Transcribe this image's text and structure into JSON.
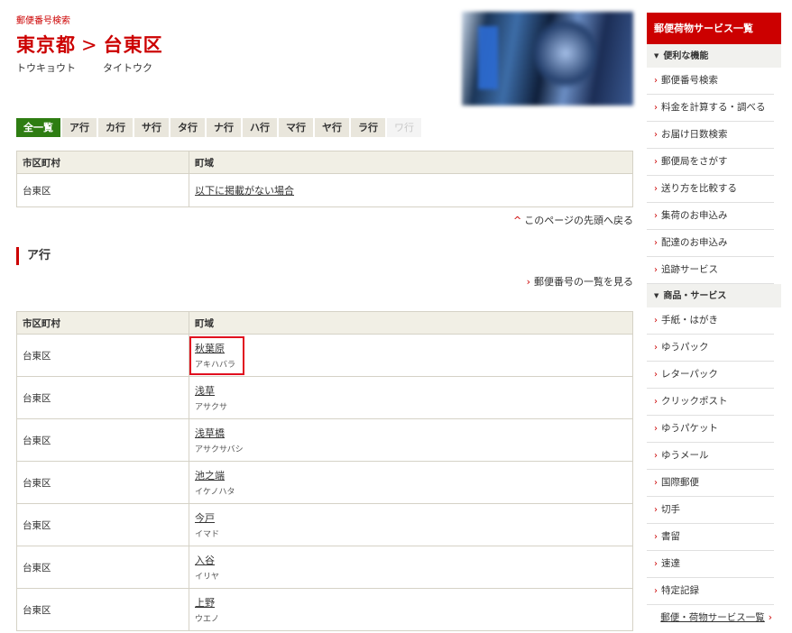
{
  "breadcrumb": "郵便番号検索",
  "title": {
    "pref": "東京都",
    "sep": ">",
    "city": "台東区"
  },
  "kana": {
    "pref": "トウキョウト",
    "city": "タイトウク"
  },
  "tabs": [
    {
      "label": "全一覧",
      "state": "active"
    },
    {
      "label": "ア行",
      "state": "normal"
    },
    {
      "label": "カ行",
      "state": "normal"
    },
    {
      "label": "サ行",
      "state": "normal"
    },
    {
      "label": "タ行",
      "state": "normal"
    },
    {
      "label": "ナ行",
      "state": "normal"
    },
    {
      "label": "ハ行",
      "state": "normal"
    },
    {
      "label": "マ行",
      "state": "normal"
    },
    {
      "label": "ヤ行",
      "state": "normal"
    },
    {
      "label": "ラ行",
      "state": "normal"
    },
    {
      "label": "ワ行",
      "state": "disabled"
    }
  ],
  "table_headers": {
    "city": "市区町村",
    "town": "町域"
  },
  "first_table": {
    "city": "台東区",
    "town": "以下に掲載がない場合"
  },
  "back_to_top": "このページの先頭へ戻る",
  "section_title": "ア行",
  "postal_list_link": "郵便番号の一覧を見る",
  "rows": [
    {
      "city": "台東区",
      "town": "秋葉原",
      "kana": "アキハバラ",
      "highlight": true
    },
    {
      "city": "台東区",
      "town": "浅草",
      "kana": "アサクサ"
    },
    {
      "city": "台東区",
      "town": "浅草橋",
      "kana": "アサクサバシ"
    },
    {
      "city": "台東区",
      "town": "池之端",
      "kana": "イケノハタ"
    },
    {
      "city": "台東区",
      "town": "今戸",
      "kana": "イマド"
    },
    {
      "city": "台東区",
      "town": "入谷",
      "kana": "イリヤ"
    },
    {
      "city": "台東区",
      "town": "上野",
      "kana": "ウエノ"
    }
  ],
  "sidebar": {
    "title": "郵便荷物サービス一覧",
    "groups": [
      {
        "label": "便利な機能",
        "items": [
          "郵便番号検索",
          "料金を計算する・調べる",
          "お届け日数検索",
          "郵便局をさがす",
          "送り方を比較する",
          "集荷のお申込み",
          "配達のお申込み",
          "追跡サービス"
        ]
      },
      {
        "label": "商品・サービス",
        "items": [
          "手紙・はがき",
          "ゆうパック",
          "レターパック",
          "クリックポスト",
          "ゆうパケット",
          "ゆうメール",
          "国際郵便",
          "切手",
          "書留",
          "速達",
          "特定記録"
        ]
      }
    ],
    "more_link": "郵便・荷物サービス一覧"
  },
  "colors": {
    "brand_red": "#cc0000",
    "tab_active_green": "#2e7d12",
    "highlight_box": "#e10f1f"
  }
}
